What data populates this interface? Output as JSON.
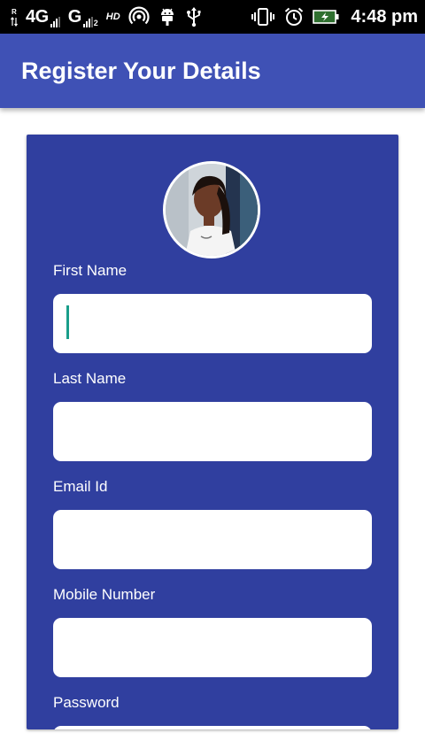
{
  "status_bar": {
    "network_4g": "4G",
    "network_g": "G",
    "sim2_label": "2",
    "hd_label": "HD",
    "time": "4:48 pm",
    "icons": [
      "data-arrows-icon",
      "signal-icon",
      "hotspot-icon",
      "android-debug-icon",
      "usb-icon",
      "vibrate-icon",
      "alarm-icon",
      "battery-charging-icon"
    ]
  },
  "app_bar": {
    "title": "Register Your Details"
  },
  "form": {
    "avatar_icon": "profile-photo",
    "fields": [
      {
        "label": "First Name",
        "value": ""
      },
      {
        "label": "Last Name",
        "value": ""
      },
      {
        "label": "Email Id",
        "value": ""
      },
      {
        "label": "Mobile Number",
        "value": ""
      },
      {
        "label": "Password",
        "value": ""
      }
    ]
  },
  "colors": {
    "app_bar": "#3f51b5",
    "card": "#303f9f",
    "caret": "#1a9e8a",
    "status_bar": "#000000"
  }
}
